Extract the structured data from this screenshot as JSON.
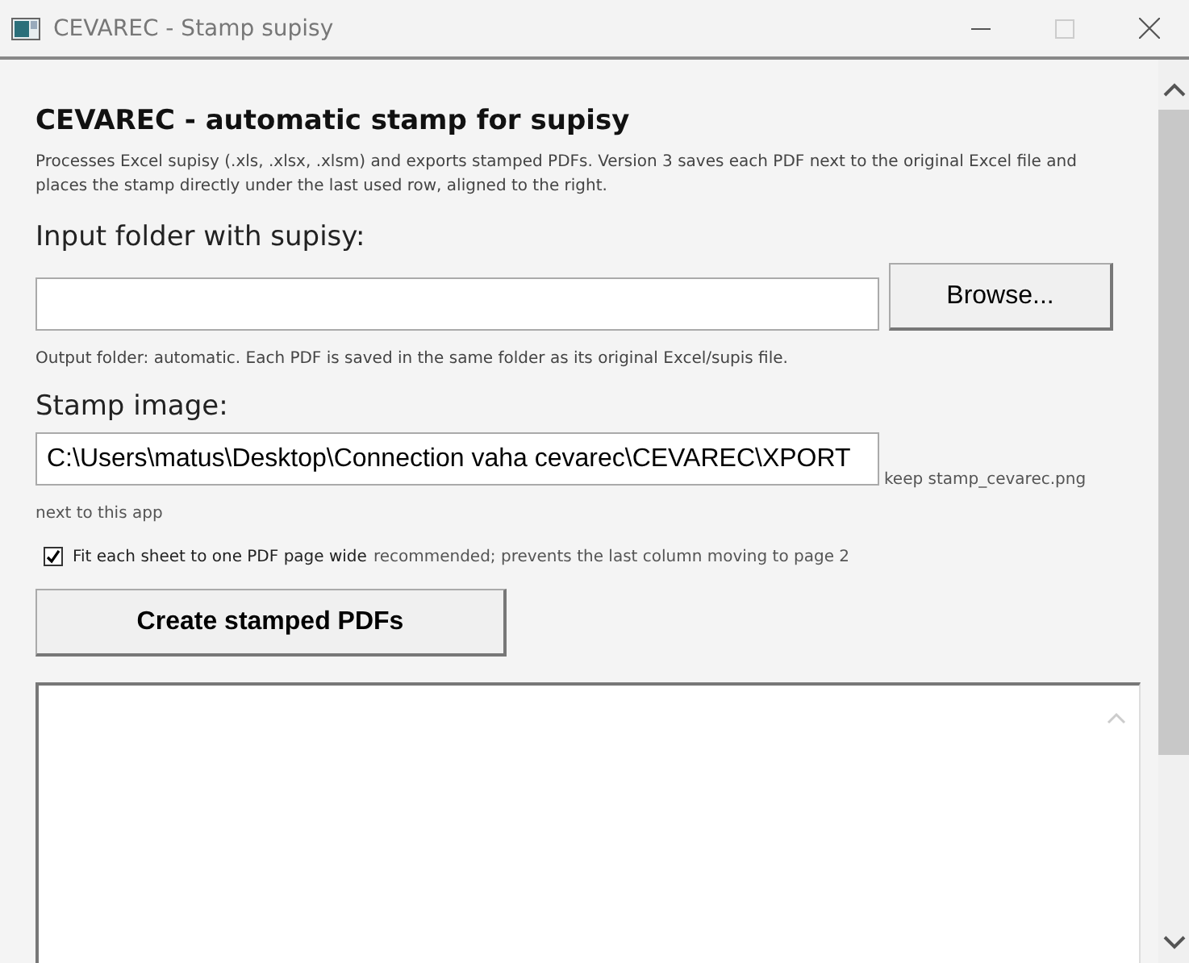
{
  "window": {
    "title": "CEVAREC - Stamp supisy"
  },
  "heading": "CEVAREC - automatic stamp for supisy",
  "description": "Processes Excel supisy (.xls, .xlsx, .xlsm) and exports stamped PDFs. Version 3 saves each PDF next to the original Excel file and places the stamp directly under the last used row, aligned to the right.",
  "input_folder": {
    "label": "Input folder with supisy:",
    "button": "Browse..."
  },
  "output_note": "Output folder: automatic. Each PDF is saved in the same folder as its original Excel/supis file.",
  "stamp_image": {
    "label": "Stamp image:",
    "value": "C:\\Users\\matus\\Desktop\\Connection vaha cevarec\\CEVAREC\\XPORT",
    "hint": "keep stamp_cevarec.png",
    "hint_continued": "next to this app"
  },
  "fit_option": {
    "label": "Fit each sheet to one PDF page wide",
    "note": "recommended; prevents the last column moving to page 2",
    "checked": true
  },
  "create_button": "Create stamped PDFs"
}
